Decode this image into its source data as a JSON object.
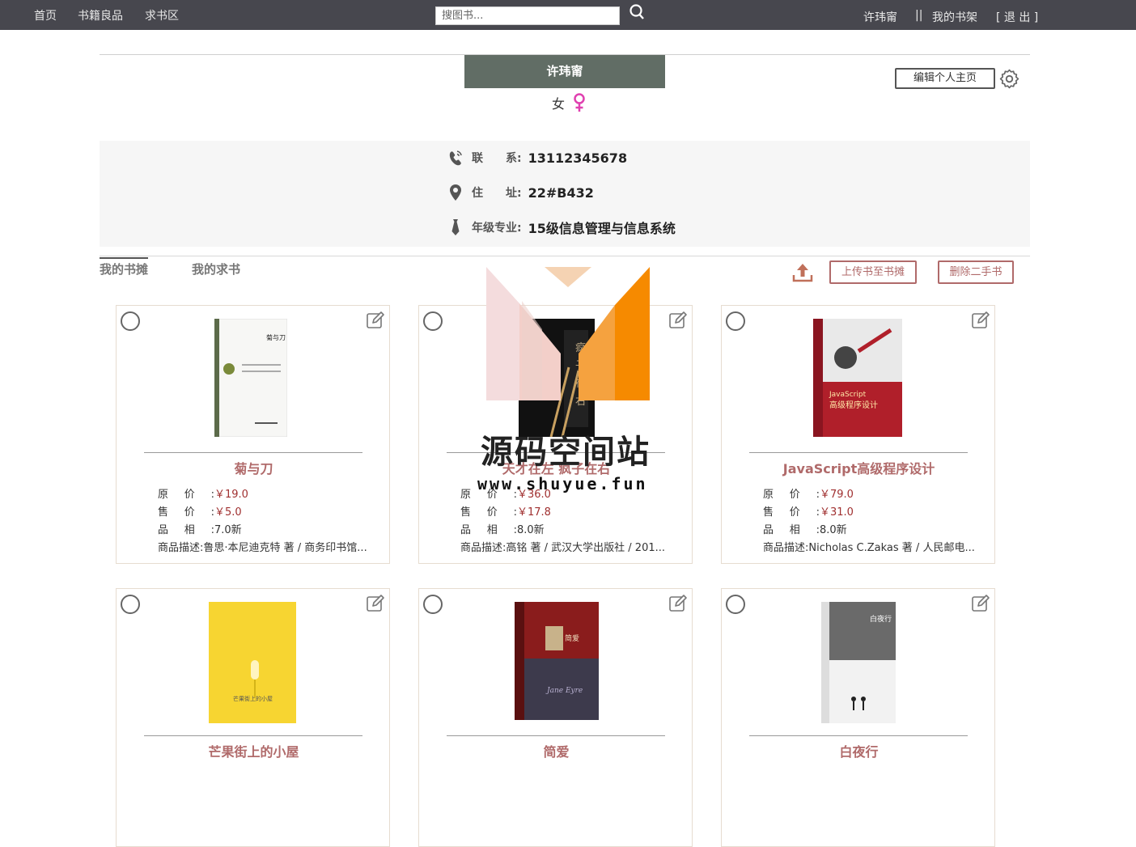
{
  "topbar": {
    "nav": [
      "首页",
      "书籍良品",
      "求书区"
    ],
    "search_placeholder": "搜图书...",
    "user_name": "许玮甯",
    "separator": "||",
    "bookshelf": "我的书架",
    "logout": "[ 退 出 ]"
  },
  "profile": {
    "name": "许玮甯",
    "gender": "女",
    "edit_button": "编辑个人主页",
    "contact_label": "联　　系:",
    "contact_value": "13112345678",
    "address_label": "住　　址:",
    "address_value": "22#B432",
    "major_label": "年级专业:",
    "major_value": "15级信息管理与信息系统"
  },
  "tabs": [
    "我的书摊",
    "我的求书"
  ],
  "actions": {
    "upload": "上传书至书摊",
    "delete": "删除二手书"
  },
  "field_labels": {
    "original": "原价:",
    "sale": "售价:",
    "condition": "品相:",
    "desc": "商品描述:"
  },
  "books": [
    {
      "title": "菊与刀",
      "original": "￥19.0",
      "sale": "￥5.0",
      "condition": "7.0新",
      "desc": "鲁思·本尼迪克特 著 / 商务印书馆..."
    },
    {
      "title": "天才在左 疯子在右",
      "original": "￥36.0",
      "sale": "￥17.8",
      "condition": "8.0新",
      "desc": "高铭 著 / 武汉大学出版社 / 201..."
    },
    {
      "title": "JavaScript高级程序设计",
      "original": "￥79.0",
      "sale": "￥31.0",
      "condition": "8.0新",
      "desc": "Nicholas C.Zakas 著 / 人民邮电..."
    },
    {
      "title": "芒果街上的小屋",
      "original": "",
      "sale": "",
      "condition": "",
      "desc": ""
    },
    {
      "title": "简爱",
      "original": "",
      "sale": "",
      "condition": "",
      "desc": ""
    },
    {
      "title": "白夜行",
      "original": "",
      "sale": "",
      "condition": "",
      "desc": ""
    }
  ],
  "watermark": {
    "text": "源码空间站",
    "url": "www.shuyue.fun"
  },
  "colors": {
    "topbar": "#47474e",
    "name_box": "#616d65",
    "accent": "#b06a6a",
    "price": "#a03030"
  }
}
